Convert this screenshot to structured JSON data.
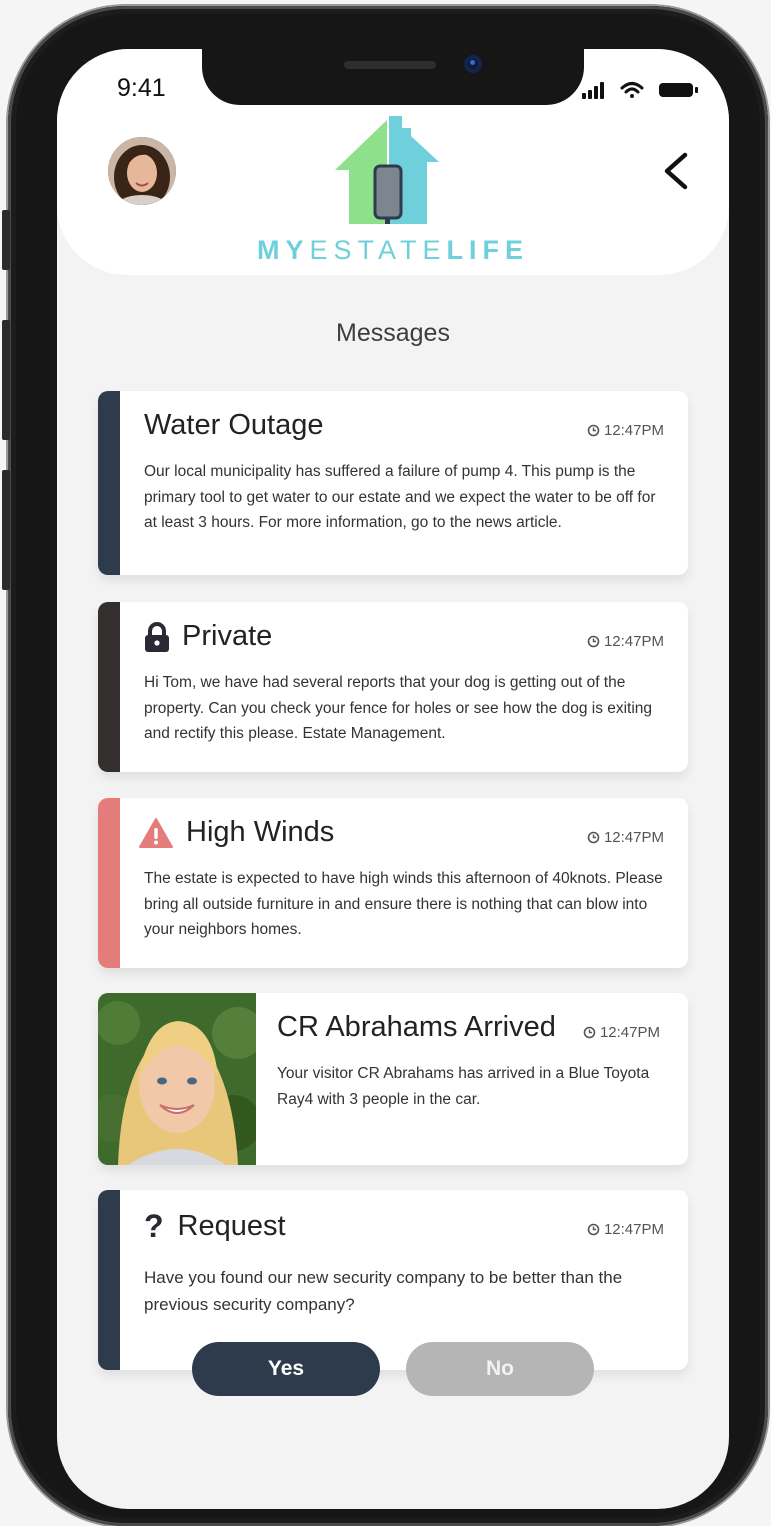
{
  "status_bar": {
    "time": "9:41"
  },
  "header": {
    "brand_my": "MY",
    "brand_estate": "ESTATE",
    "brand_life": "LIFE",
    "avatar_icon": "user-avatar",
    "back_icon": "chevron-left-icon"
  },
  "page_title": "Messages",
  "messages": [
    {
      "title": "Water Outage",
      "time": "12:47PM",
      "body": "Our local municipality has suffered a failure of pump 4. This pump is the primary tool to get water to our estate and we expect the water to be off for at least 3 hours. For more information, go to the news article.",
      "accent": "#2d3b4d",
      "icon": ""
    },
    {
      "title": "Private",
      "time": "12:47PM",
      "body": "Hi Tom, we have had several reports that your dog is getting out of the property. Can you check your fence for holes or see how the dog is exiting and rectify this please. Estate Management.",
      "accent": "#332f2f",
      "icon": "lock-icon"
    },
    {
      "title": "High Winds",
      "time": "12:47PM",
      "body": "The estate is expected to have high winds this afternoon of 40knots. Please bring all outside furniture in and ensure there is nothing that can blow into your neighbors homes.",
      "accent": "#e47c7c",
      "icon": "warning-icon"
    },
    {
      "title": "CR Abrahams Arrived",
      "time": "12:47PM",
      "body": "Your visitor CR Abrahams has arrived in a Blue Toyota Ray4 with 3 people in the car.",
      "icon": "visitor-photo"
    },
    {
      "title": "Request",
      "time": "12:47PM",
      "body": "Have you found our new security company to be better than the previous security company?",
      "accent": "#2d3b4d",
      "icon": "question-icon"
    }
  ],
  "actions": {
    "yes_label": "Yes",
    "no_label": "No"
  },
  "colors": {
    "brand": "#6fd0dc",
    "logo_green": "#8ee08a",
    "dark": "#2d3b4d",
    "alert": "#e47c7c",
    "disabled": "#b5b5b5"
  }
}
